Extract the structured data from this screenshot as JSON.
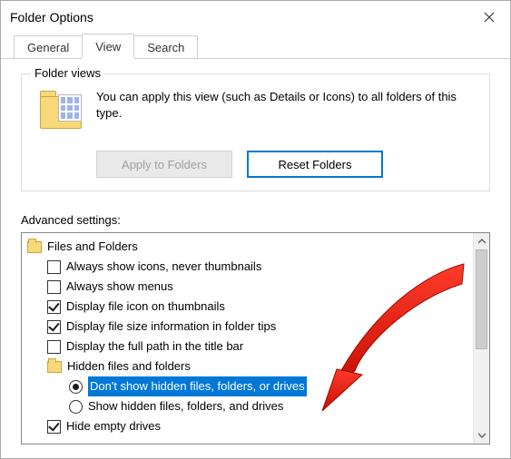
{
  "window": {
    "title": "Folder Options"
  },
  "tabs": {
    "general": "General",
    "view": "View",
    "search": "Search"
  },
  "folder_views": {
    "legend": "Folder views",
    "description": "You can apply this view (such as Details or Icons) to all folders of this type.",
    "apply_btn": "Apply to Folders",
    "reset_btn": "Reset Folders"
  },
  "advanced": {
    "label": "Advanced settings:",
    "root": "Files and Folders",
    "items": [
      {
        "type": "check",
        "checked": false,
        "label": "Always show icons, never thumbnails"
      },
      {
        "type": "check",
        "checked": false,
        "label": "Always show menus"
      },
      {
        "type": "check",
        "checked": true,
        "label": "Display file icon on thumbnails"
      },
      {
        "type": "check",
        "checked": true,
        "label": "Display file size information in folder tips"
      },
      {
        "type": "check",
        "checked": false,
        "label": "Display the full path in the title bar"
      }
    ],
    "hidden_group": {
      "label": "Hidden files and folders",
      "options": [
        {
          "checked": true,
          "selected": true,
          "label": "Don't show hidden files, folders, or drives"
        },
        {
          "checked": false,
          "selected": false,
          "label": "Show hidden files, folders, and drives"
        }
      ]
    },
    "after": [
      {
        "type": "check",
        "checked": true,
        "label": "Hide empty drives"
      }
    ]
  }
}
